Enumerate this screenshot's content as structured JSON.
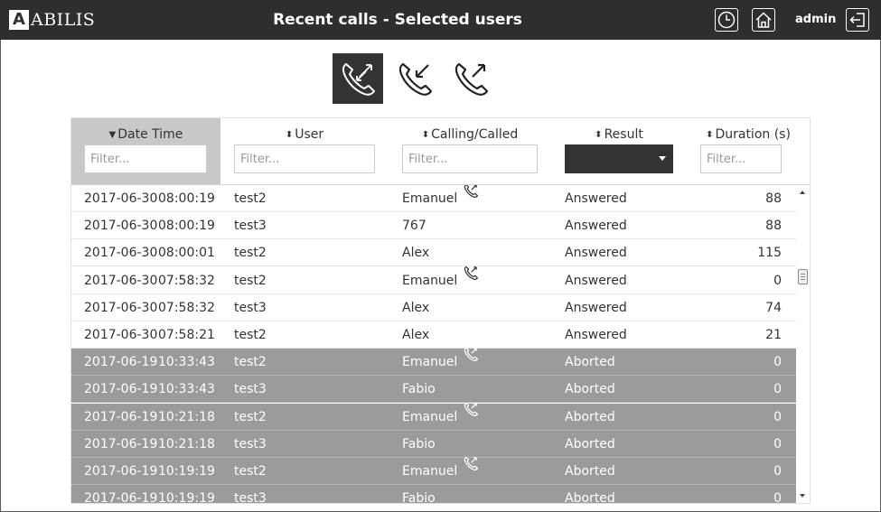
{
  "app": {
    "logo_letter": "A",
    "logo_text": "ABILIS",
    "title": "Recent calls - Selected users",
    "user": "admin",
    "colors": {
      "topbar": "#2e2e2e",
      "aborted_row": "#9b9b9b",
      "active_filter": "#333333",
      "sorted_header": "#c8c8c8"
    }
  },
  "toolbar": {
    "icons": [
      "clock-icon",
      "home-icon",
      "logout-icon"
    ],
    "direction_buttons": [
      {
        "name": "all-calls-icon",
        "active": true
      },
      {
        "name": "incoming-calls-icon",
        "active": false
      },
      {
        "name": "outgoing-calls-icon",
        "active": false
      }
    ]
  },
  "table": {
    "columns": [
      {
        "key": "datetime",
        "label": "Date Time",
        "sort": "desc",
        "placeholder": "Filter..."
      },
      {
        "key": "user",
        "label": "User",
        "sort": "none",
        "placeholder": "Filter..."
      },
      {
        "key": "called",
        "label": "Calling/Called",
        "sort": "none",
        "placeholder": "Filter..."
      },
      {
        "key": "result",
        "label": "Result",
        "sort": "none",
        "selected": ""
      },
      {
        "key": "duration",
        "label": "Duration (s)",
        "sort": "none",
        "placeholder": "Filter..."
      }
    ],
    "rows": [
      {
        "date": "2017-06-30",
        "time": "08:00:19",
        "user": "test2",
        "called": "Emanuel",
        "direction_icon": "outgoing-call-icon",
        "result": "Answered",
        "duration": "88"
      },
      {
        "date": "2017-06-30",
        "time": "08:00:19",
        "user": "test3",
        "called": "767",
        "direction_icon": "",
        "result": "Answered",
        "duration": "88"
      },
      {
        "date": "2017-06-30",
        "time": "08:00:01",
        "user": "test2",
        "called": "Alex",
        "direction_icon": "",
        "result": "Answered",
        "duration": "115"
      },
      {
        "date": "2017-06-30",
        "time": "07:58:32",
        "user": "test2",
        "called": "Emanuel",
        "direction_icon": "outgoing-call-icon",
        "result": "Answered",
        "duration": "0"
      },
      {
        "date": "2017-06-30",
        "time": "07:58:32",
        "user": "test3",
        "called": "Alex",
        "direction_icon": "",
        "result": "Answered",
        "duration": "74"
      },
      {
        "date": "2017-06-30",
        "time": "07:58:21",
        "user": "test2",
        "called": "Alex",
        "direction_icon": "",
        "result": "Answered",
        "duration": "21"
      },
      {
        "date": "2017-06-19",
        "time": "10:33:43",
        "user": "test2",
        "called": "Emanuel",
        "direction_icon": "outgoing-call-icon",
        "result": "Aborted",
        "duration": "0"
      },
      {
        "date": "2017-06-19",
        "time": "10:33:43",
        "user": "test3",
        "called": "Fabio",
        "direction_icon": "",
        "result": "Aborted",
        "duration": "0"
      },
      {
        "date": "2017-06-19",
        "time": "10:21:18",
        "user": "test2",
        "called": "Emanuel",
        "direction_icon": "outgoing-call-icon",
        "result": "Aborted",
        "duration": "0"
      },
      {
        "date": "2017-06-19",
        "time": "10:21:18",
        "user": "test3",
        "called": "Fabio",
        "direction_icon": "",
        "result": "Aborted",
        "duration": "0"
      },
      {
        "date": "2017-06-19",
        "time": "10:19:19",
        "user": "test2",
        "called": "Emanuel",
        "direction_icon": "outgoing-call-icon",
        "result": "Aborted",
        "duration": "0"
      },
      {
        "date": "2017-06-19",
        "time": "10:19:19",
        "user": "test3",
        "called": "Fabio",
        "direction_icon": "",
        "result": "Aborted",
        "duration": "0"
      }
    ]
  }
}
